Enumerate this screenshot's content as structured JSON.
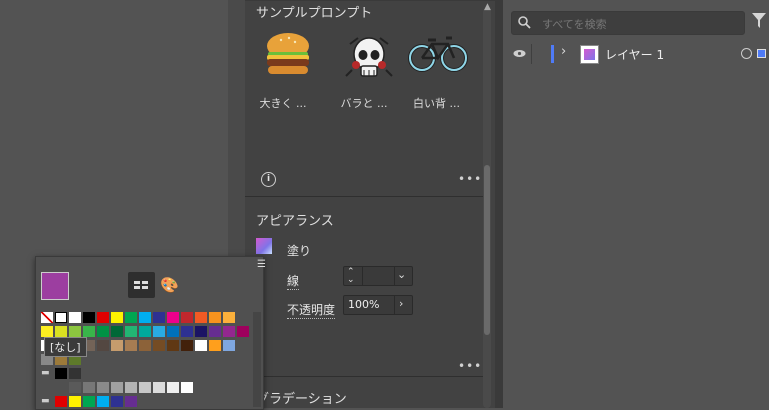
{
  "sample_prompts": {
    "title": "サンプルプロンプト",
    "items": [
      {
        "label": "大きく ..."
      },
      {
        "label": "バラと ..."
      },
      {
        "label": "白い背 ..."
      }
    ]
  },
  "appearance": {
    "title": "アピアランス",
    "fill_label": "塗り",
    "stroke_label": "線",
    "opacity_label": "不透明度",
    "opacity_value": "100%",
    "gradient_title": "グラデーション"
  },
  "layers": {
    "search_placeholder": "すべてを検索",
    "layer_name": "レイヤー 1"
  },
  "swatches": {
    "tooltip": "[なし]",
    "current_fill_color": "#9c3ea0"
  },
  "icons": [
    "info-icon",
    "more-icon",
    "eye-icon",
    "filter-icon",
    "search-icon",
    "chevron-right-icon",
    "chevron-down-icon",
    "stepper-icon",
    "swatch-grid-icon",
    "swatch-library-icon",
    "folder-icon",
    "menu-icon"
  ]
}
